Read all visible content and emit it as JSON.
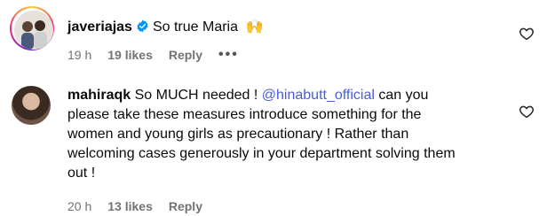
{
  "comments": [
    {
      "username": "javeriajas",
      "verified": true,
      "text": "So true Maria",
      "emoji": "🙌",
      "time": "19 h",
      "likes": "19 likes",
      "reply": "Reply",
      "more": "•••"
    },
    {
      "username": "mahiraqk",
      "text_before": "So MUCH needed ! ",
      "mention": "@hinabutt_official",
      "text_line1_rest": " can you",
      "text_line2": "please take these measures introduce something for the",
      "text_line3": "women and young girls as precautionary ! Rather than",
      "text_line4": "welcoming cases generously in your department solving them",
      "text_line5": "out !",
      "time": "20 h",
      "likes": "13 likes",
      "reply": "Reply"
    }
  ],
  "colors": {
    "mention": "#4a5bd8",
    "meta": "#737373",
    "verified": "#0095f6"
  },
  "icons": {
    "like": "heart-outline-icon",
    "verified": "verified-badge-icon",
    "more": "more-horizontal-icon"
  }
}
